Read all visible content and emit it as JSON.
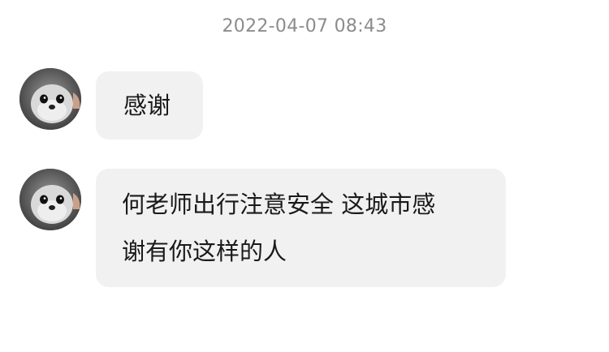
{
  "timestamp": "2022-04-07 08:43",
  "messages": [
    {
      "avatar_icon": "seal-avatar-icon",
      "lines": [
        "感谢"
      ]
    },
    {
      "avatar_icon": "seal-avatar-icon",
      "lines": [
        "何老师出行注意安全 这城市感",
        "谢有你这样的人"
      ]
    }
  ],
  "colors": {
    "background": "#ffffff",
    "bubble": "#f1f1f1",
    "text": "#1a1a1a",
    "timestamp": "#8c8c8c"
  }
}
